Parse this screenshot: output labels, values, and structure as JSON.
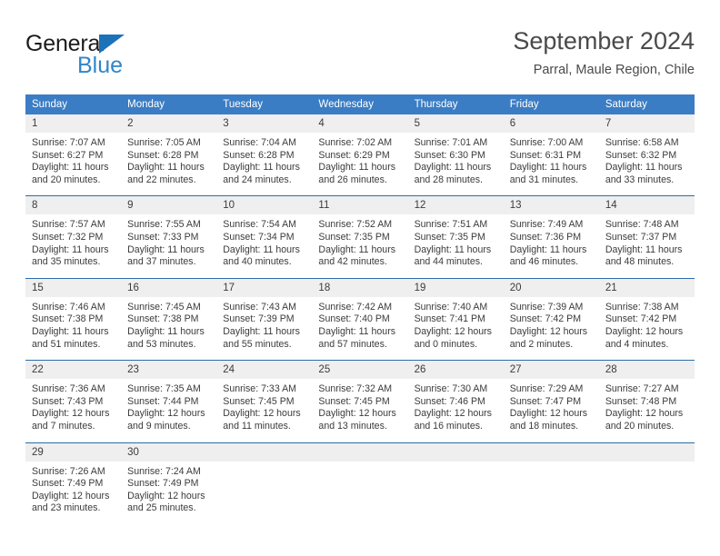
{
  "logo": {
    "primary_text": "General",
    "secondary_text": "Blue",
    "triangle_icon": "triangle-icon",
    "primary_color": "#1c1c1c",
    "secondary_color": "#2f86c8",
    "triangle_color": "#1c72b8"
  },
  "header": {
    "title": "September 2024",
    "subtitle": "Parral, Maule Region, Chile"
  },
  "theme": {
    "header_row_bg": "#3b7dc4",
    "daynum_bg": "#efefef",
    "week_divider": "#2d6da8",
    "text": "#3b3b3b"
  },
  "weekdays": [
    "Sunday",
    "Monday",
    "Tuesday",
    "Wednesday",
    "Thursday",
    "Friday",
    "Saturday"
  ],
  "weeks": [
    [
      {
        "day": "1",
        "sunrise": "Sunrise: 7:07 AM",
        "sunset": "Sunset: 6:27 PM",
        "daylight_line1": "Daylight: 11 hours",
        "daylight_line2": "and 20 minutes."
      },
      {
        "day": "2",
        "sunrise": "Sunrise: 7:05 AM",
        "sunset": "Sunset: 6:28 PM",
        "daylight_line1": "Daylight: 11 hours",
        "daylight_line2": "and 22 minutes."
      },
      {
        "day": "3",
        "sunrise": "Sunrise: 7:04 AM",
        "sunset": "Sunset: 6:28 PM",
        "daylight_line1": "Daylight: 11 hours",
        "daylight_line2": "and 24 minutes."
      },
      {
        "day": "4",
        "sunrise": "Sunrise: 7:02 AM",
        "sunset": "Sunset: 6:29 PM",
        "daylight_line1": "Daylight: 11 hours",
        "daylight_line2": "and 26 minutes."
      },
      {
        "day": "5",
        "sunrise": "Sunrise: 7:01 AM",
        "sunset": "Sunset: 6:30 PM",
        "daylight_line1": "Daylight: 11 hours",
        "daylight_line2": "and 28 minutes."
      },
      {
        "day": "6",
        "sunrise": "Sunrise: 7:00 AM",
        "sunset": "Sunset: 6:31 PM",
        "daylight_line1": "Daylight: 11 hours",
        "daylight_line2": "and 31 minutes."
      },
      {
        "day": "7",
        "sunrise": "Sunrise: 6:58 AM",
        "sunset": "Sunset: 6:32 PM",
        "daylight_line1": "Daylight: 11 hours",
        "daylight_line2": "and 33 minutes."
      }
    ],
    [
      {
        "day": "8",
        "sunrise": "Sunrise: 7:57 AM",
        "sunset": "Sunset: 7:32 PM",
        "daylight_line1": "Daylight: 11 hours",
        "daylight_line2": "and 35 minutes."
      },
      {
        "day": "9",
        "sunrise": "Sunrise: 7:55 AM",
        "sunset": "Sunset: 7:33 PM",
        "daylight_line1": "Daylight: 11 hours",
        "daylight_line2": "and 37 minutes."
      },
      {
        "day": "10",
        "sunrise": "Sunrise: 7:54 AM",
        "sunset": "Sunset: 7:34 PM",
        "daylight_line1": "Daylight: 11 hours",
        "daylight_line2": "and 40 minutes."
      },
      {
        "day": "11",
        "sunrise": "Sunrise: 7:52 AM",
        "sunset": "Sunset: 7:35 PM",
        "daylight_line1": "Daylight: 11 hours",
        "daylight_line2": "and 42 minutes."
      },
      {
        "day": "12",
        "sunrise": "Sunrise: 7:51 AM",
        "sunset": "Sunset: 7:35 PM",
        "daylight_line1": "Daylight: 11 hours",
        "daylight_line2": "and 44 minutes."
      },
      {
        "day": "13",
        "sunrise": "Sunrise: 7:49 AM",
        "sunset": "Sunset: 7:36 PM",
        "daylight_line1": "Daylight: 11 hours",
        "daylight_line2": "and 46 minutes."
      },
      {
        "day": "14",
        "sunrise": "Sunrise: 7:48 AM",
        "sunset": "Sunset: 7:37 PM",
        "daylight_line1": "Daylight: 11 hours",
        "daylight_line2": "and 48 minutes."
      }
    ],
    [
      {
        "day": "15",
        "sunrise": "Sunrise: 7:46 AM",
        "sunset": "Sunset: 7:38 PM",
        "daylight_line1": "Daylight: 11 hours",
        "daylight_line2": "and 51 minutes."
      },
      {
        "day": "16",
        "sunrise": "Sunrise: 7:45 AM",
        "sunset": "Sunset: 7:38 PM",
        "daylight_line1": "Daylight: 11 hours",
        "daylight_line2": "and 53 minutes."
      },
      {
        "day": "17",
        "sunrise": "Sunrise: 7:43 AM",
        "sunset": "Sunset: 7:39 PM",
        "daylight_line1": "Daylight: 11 hours",
        "daylight_line2": "and 55 minutes."
      },
      {
        "day": "18",
        "sunrise": "Sunrise: 7:42 AM",
        "sunset": "Sunset: 7:40 PM",
        "daylight_line1": "Daylight: 11 hours",
        "daylight_line2": "and 57 minutes."
      },
      {
        "day": "19",
        "sunrise": "Sunrise: 7:40 AM",
        "sunset": "Sunset: 7:41 PM",
        "daylight_line1": "Daylight: 12 hours",
        "daylight_line2": "and 0 minutes."
      },
      {
        "day": "20",
        "sunrise": "Sunrise: 7:39 AM",
        "sunset": "Sunset: 7:42 PM",
        "daylight_line1": "Daylight: 12 hours",
        "daylight_line2": "and 2 minutes."
      },
      {
        "day": "21",
        "sunrise": "Sunrise: 7:38 AM",
        "sunset": "Sunset: 7:42 PM",
        "daylight_line1": "Daylight: 12 hours",
        "daylight_line2": "and 4 minutes."
      }
    ],
    [
      {
        "day": "22",
        "sunrise": "Sunrise: 7:36 AM",
        "sunset": "Sunset: 7:43 PM",
        "daylight_line1": "Daylight: 12 hours",
        "daylight_line2": "and 7 minutes."
      },
      {
        "day": "23",
        "sunrise": "Sunrise: 7:35 AM",
        "sunset": "Sunset: 7:44 PM",
        "daylight_line1": "Daylight: 12 hours",
        "daylight_line2": "and 9 minutes."
      },
      {
        "day": "24",
        "sunrise": "Sunrise: 7:33 AM",
        "sunset": "Sunset: 7:45 PM",
        "daylight_line1": "Daylight: 12 hours",
        "daylight_line2": "and 11 minutes."
      },
      {
        "day": "25",
        "sunrise": "Sunrise: 7:32 AM",
        "sunset": "Sunset: 7:45 PM",
        "daylight_line1": "Daylight: 12 hours",
        "daylight_line2": "and 13 minutes."
      },
      {
        "day": "26",
        "sunrise": "Sunrise: 7:30 AM",
        "sunset": "Sunset: 7:46 PM",
        "daylight_line1": "Daylight: 12 hours",
        "daylight_line2": "and 16 minutes."
      },
      {
        "day": "27",
        "sunrise": "Sunrise: 7:29 AM",
        "sunset": "Sunset: 7:47 PM",
        "daylight_line1": "Daylight: 12 hours",
        "daylight_line2": "and 18 minutes."
      },
      {
        "day": "28",
        "sunrise": "Sunrise: 7:27 AM",
        "sunset": "Sunset: 7:48 PM",
        "daylight_line1": "Daylight: 12 hours",
        "daylight_line2": "and 20 minutes."
      }
    ],
    [
      {
        "day": "29",
        "sunrise": "Sunrise: 7:26 AM",
        "sunset": "Sunset: 7:49 PM",
        "daylight_line1": "Daylight: 12 hours",
        "daylight_line2": "and 23 minutes."
      },
      {
        "day": "30",
        "sunrise": "Sunrise: 7:24 AM",
        "sunset": "Sunset: 7:49 PM",
        "daylight_line1": "Daylight: 12 hours",
        "daylight_line2": "and 25 minutes."
      },
      {
        "day": "",
        "sunrise": "",
        "sunset": "",
        "daylight_line1": "",
        "daylight_line2": ""
      },
      {
        "day": "",
        "sunrise": "",
        "sunset": "",
        "daylight_line1": "",
        "daylight_line2": ""
      },
      {
        "day": "",
        "sunrise": "",
        "sunset": "",
        "daylight_line1": "",
        "daylight_line2": ""
      },
      {
        "day": "",
        "sunrise": "",
        "sunset": "",
        "daylight_line1": "",
        "daylight_line2": ""
      },
      {
        "day": "",
        "sunrise": "",
        "sunset": "",
        "daylight_line1": "",
        "daylight_line2": ""
      }
    ]
  ]
}
